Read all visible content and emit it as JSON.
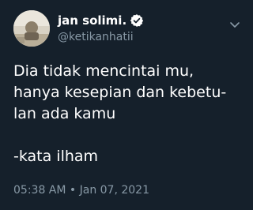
{
  "author": {
    "display_name": "jan solimi.",
    "handle": "@ketikanhatii",
    "avatar_icon": "avatar-photo",
    "verified_icon": "verified-badge-icon"
  },
  "tweet": {
    "lines": [
      "Dia tidak mencintai mu,",
      "hanya kesepian dan kebetu-",
      "lan ada kamu",
      "",
      "-kata ilham"
    ],
    "timestamp": "05:38 AM • Jan 07, 2021"
  },
  "colors": {
    "background": "#15202b",
    "text": "#ffffff",
    "muted": "#8899a6"
  },
  "menu_icon": "chevron-down-icon"
}
